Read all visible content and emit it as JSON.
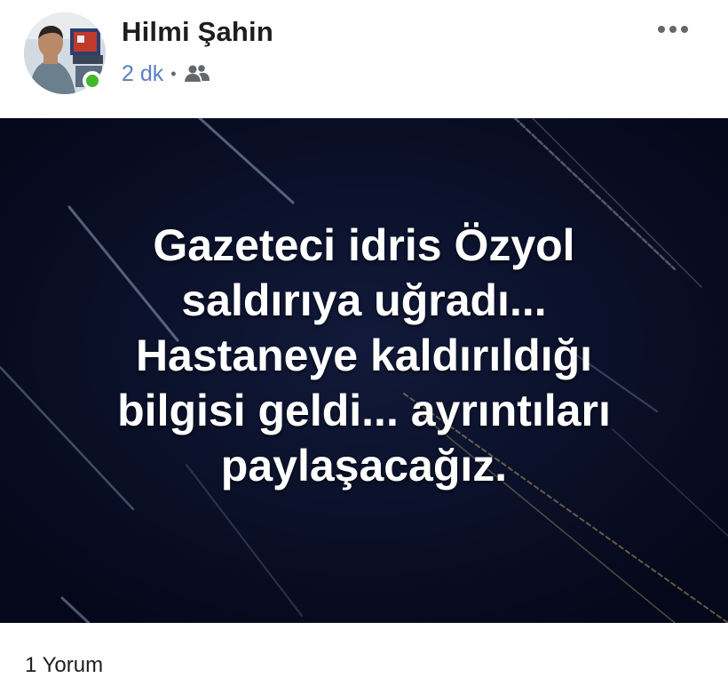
{
  "post": {
    "author": {
      "name": "Hilmi Şahin",
      "online": true
    },
    "timestamp": "2 dk",
    "audience_icon": "friends-icon",
    "more_icon": "more-horizontal-icon",
    "image": {
      "background_color": "#070b1e",
      "text_lines": [
        "Gazeteci idris Özyol",
        "saldırıya uğradı...",
        "Hastaneye kaldırıldığı",
        "bilgisi geldi... ayrıntıları",
        "paylaşacağız."
      ]
    },
    "footer": {
      "comment_count": "1 Yorum"
    }
  },
  "colors": {
    "name": "#1c1e21",
    "timestamp": "#5b7fc1",
    "online": "#42b72a",
    "icon": "#65676b"
  }
}
